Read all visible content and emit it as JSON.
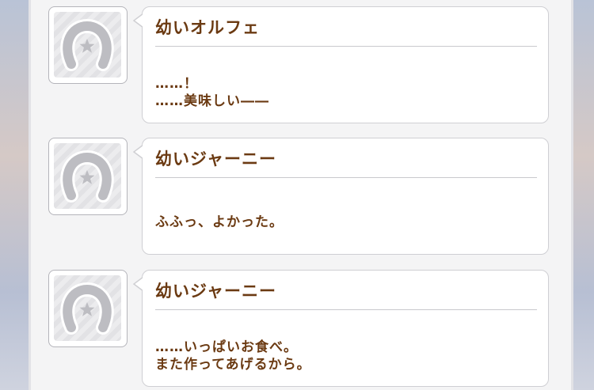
{
  "log": [
    {
      "speaker": "幼いオルフェ",
      "lines": [
        "……！",
        "……美味しい――"
      ]
    },
    {
      "speaker": "幼いジャーニー",
      "lines": [
        "ふふっ、よかった。"
      ]
    },
    {
      "speaker": "幼いジャーニー",
      "lines": [
        "……いっぱいお食べ。",
        "また作ってあげるから。"
      ]
    }
  ],
  "avatar_icon": "horseshoe-star-icon",
  "colors": {
    "text": "#6b3a12",
    "bubble": "#ffffff",
    "panel": "#f4f4f5"
  }
}
